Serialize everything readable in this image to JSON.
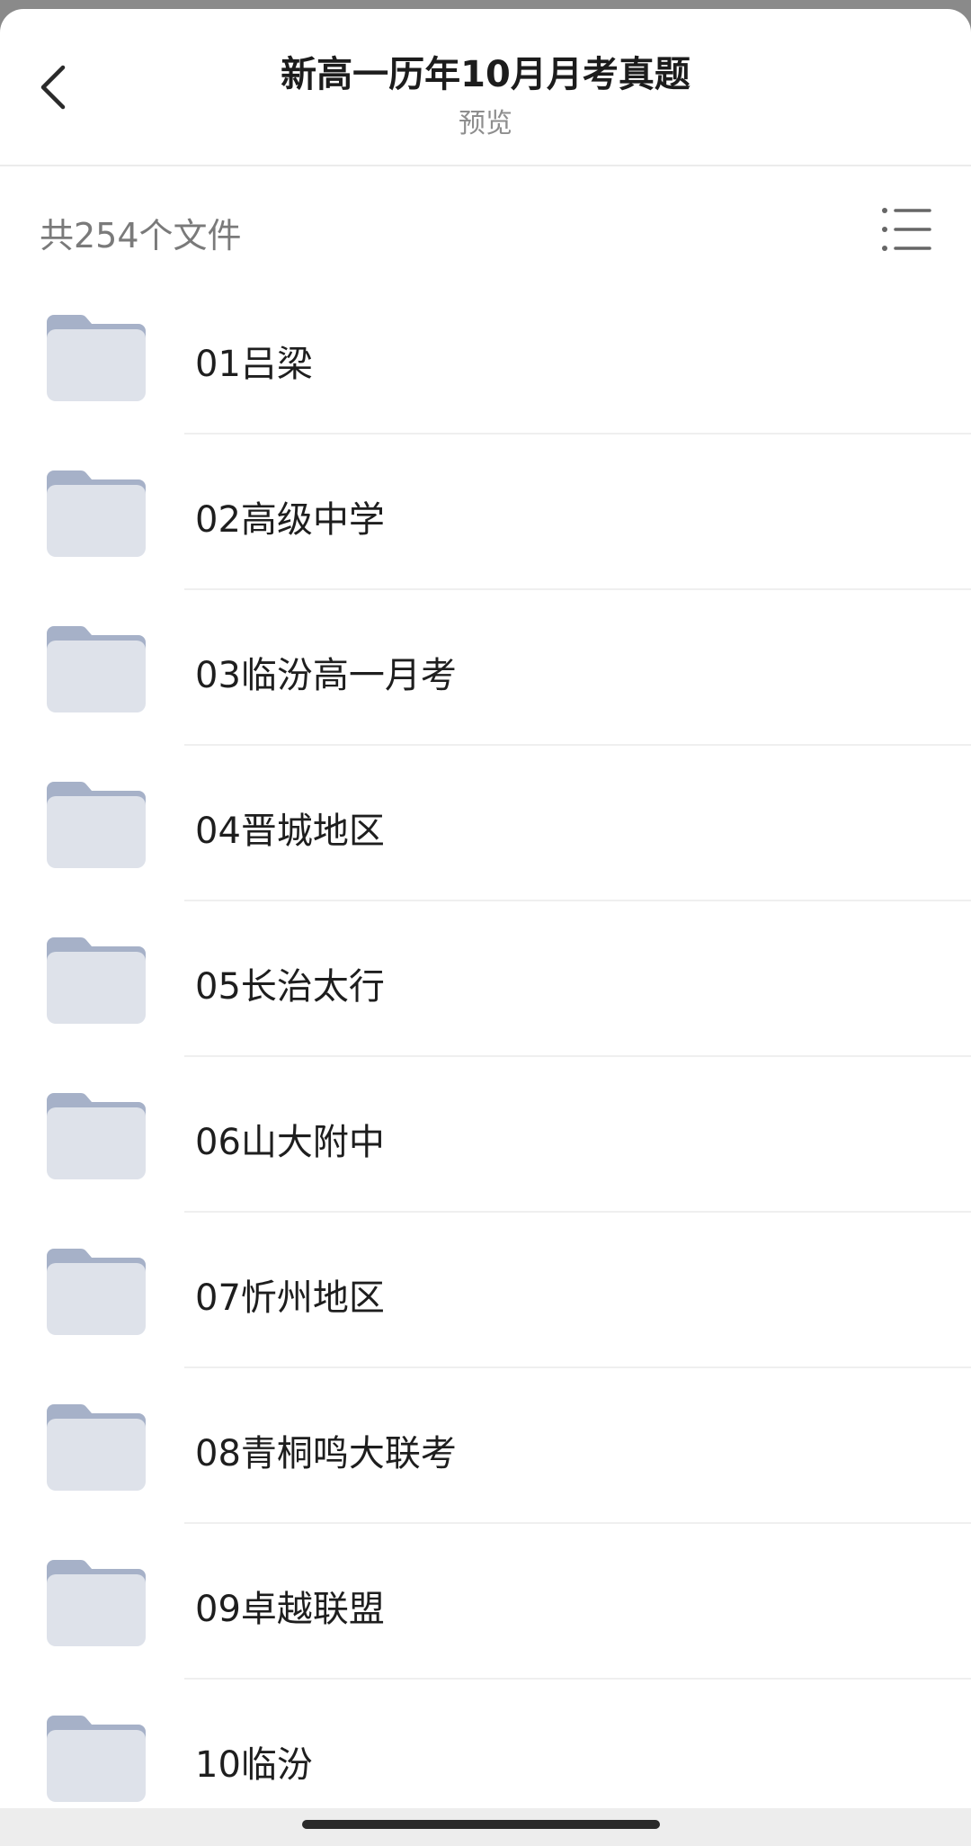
{
  "header": {
    "title": "新高一历年10月月考真题",
    "subtitle": "预览",
    "back_icon": "chevron-left-icon"
  },
  "toolbar": {
    "file_count": "共254个文件",
    "view_icon": "list-view-icon"
  },
  "folders": [
    {
      "name": "01吕梁"
    },
    {
      "name": "02高级中学"
    },
    {
      "name": "03临汾高一月考"
    },
    {
      "name": "04晋城地区"
    },
    {
      "name": "05长治太行"
    },
    {
      "name": "06山大附中"
    },
    {
      "name": "07忻州地区"
    },
    {
      "name": "08青桐鸣大联考"
    },
    {
      "name": "09卓越联盟"
    },
    {
      "name": "10临汾"
    }
  ],
  "colors": {
    "folder_tab": "#a6b1c8",
    "folder_body": "#dee2ea",
    "divider": "#efefef",
    "text_primary": "#1e1e1e",
    "text_secondary": "#8e8e8e"
  }
}
